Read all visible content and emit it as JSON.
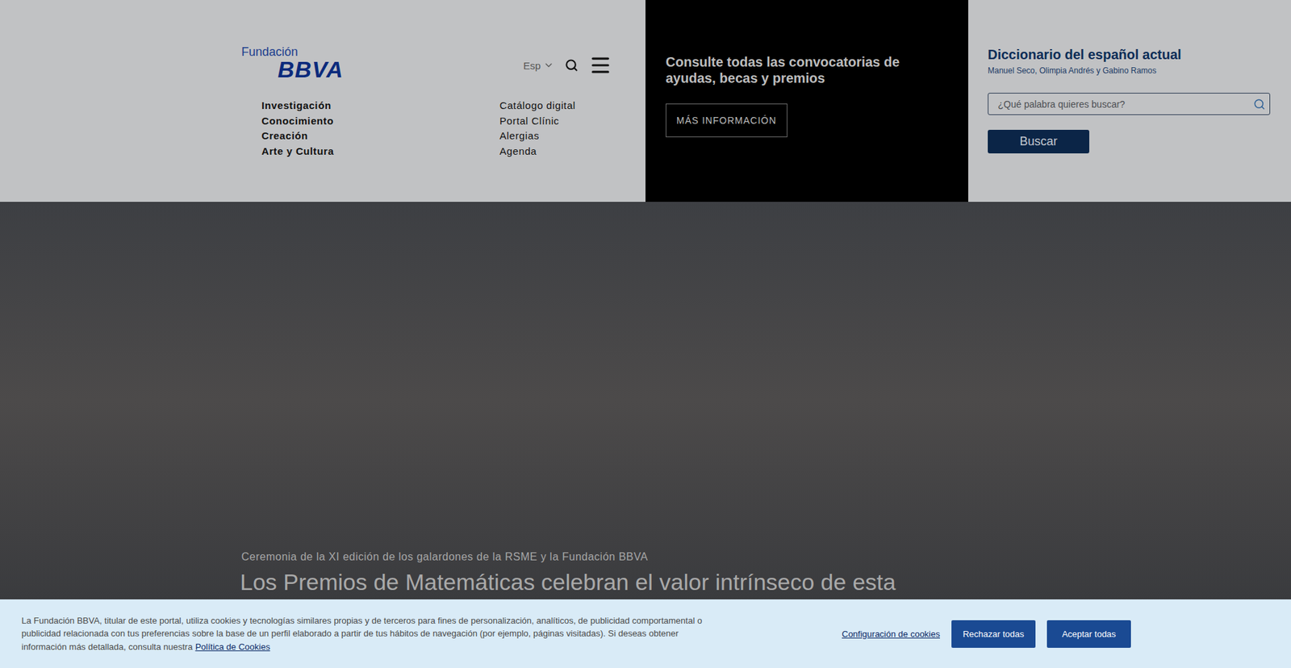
{
  "header": {
    "logo": {
      "top": "Fundación",
      "main": "BBVA"
    },
    "language": "Esp",
    "nav_primary": [
      "Investigación",
      "Conocimiento",
      "Creación",
      "Arte y Cultura"
    ],
    "nav_secondary": [
      "Catálogo digital",
      "Portal Clínic",
      "Alergias",
      "Agenda"
    ]
  },
  "promo": {
    "title": "Consulte todas las convocatorias de ayudas, becas y premios",
    "button": "MÁS INFORMACIÓN"
  },
  "dictionary": {
    "title": "Diccionario del español actual",
    "authors": "Manuel Seco, Olimpia Andrés y Gabino Ramos",
    "placeholder": "¿Qué palabra quieres buscar?",
    "button": "Buscar"
  },
  "hero": {
    "caption": "Ceremonia de la XI edición de los galardones de la RSME y la Fundación BBVA",
    "title": "Los Premios de Matemáticas celebran el valor intrínseco de esta"
  },
  "cookie_banner": {
    "text": "La Fundación BBVA, titular de este portal, utiliza cookies y tecnologías similares propias y de terceros para fines de personalización, analíticos, de publicidad comportamental o publicidad relacionada con tus preferencias sobre la base de un perfil elaborado a partir de tus hábitos de navegación (por ejemplo, páginas visitadas). Si deseas obtener información más detallada, consulta nuestra",
    "link": "Política de Cookies",
    "settings": "Configuración de cookies",
    "buttons": [
      "Rechazar todas",
      "Aceptar todas"
    ]
  }
}
